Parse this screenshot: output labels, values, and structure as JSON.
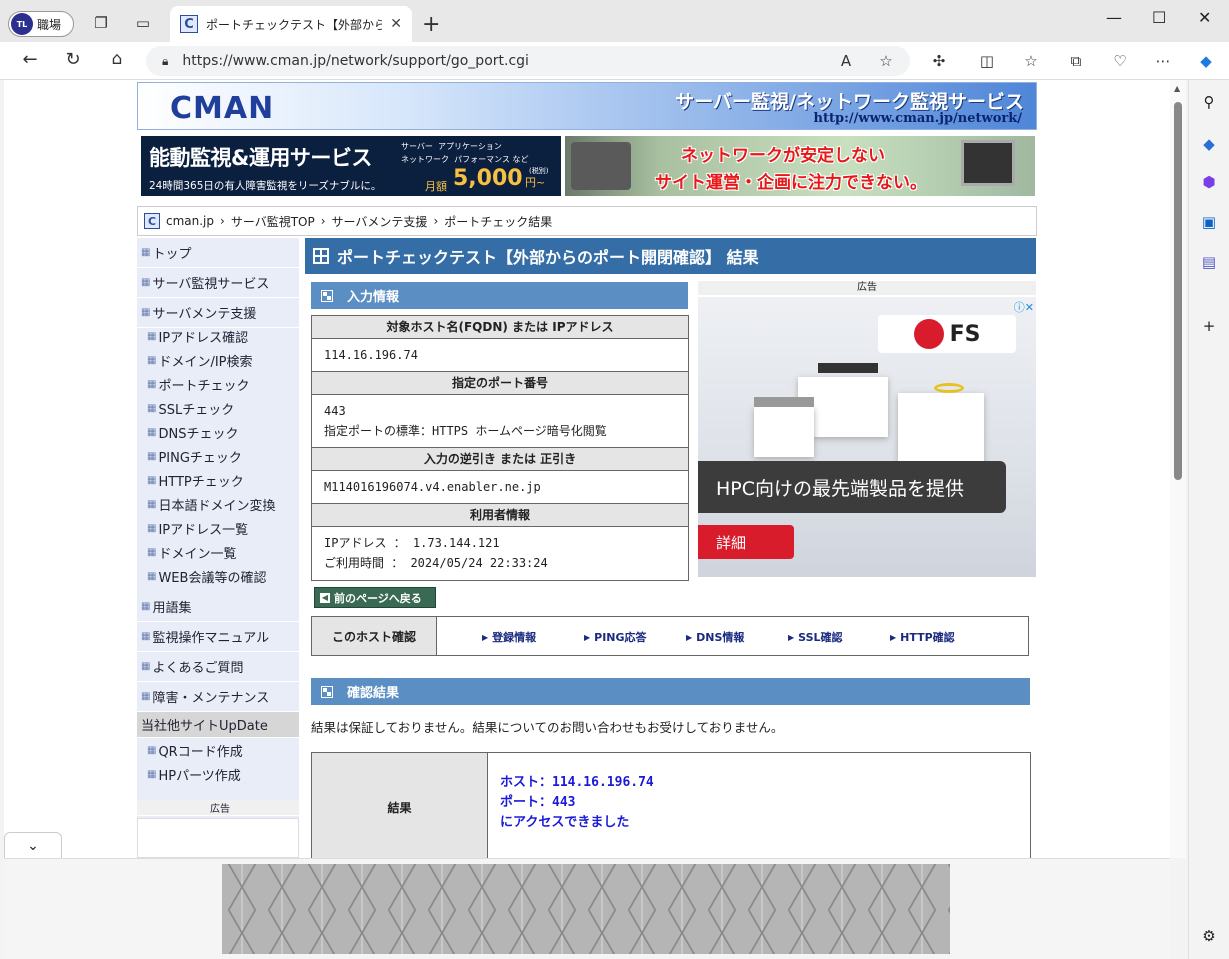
{
  "browser": {
    "profile_label": "職場",
    "profile_avatar": "TL",
    "tab_title": "ポートチェックテスト【外部からのポート開閉確認】",
    "url": "https://www.cman.jp/network/support/go_port.cgi",
    "icons": [
      "workspaces-icon",
      "tab-actions-icon",
      "close-icon",
      "new-tab-icon",
      "minimize-icon",
      "maximize-icon",
      "back-icon",
      "refresh-icon",
      "home-icon",
      "lock-icon",
      "read-aloud-icon",
      "favorite-star-icon",
      "extensions-icon",
      "split-screen-icon",
      "favorites-icon",
      "collections-icon",
      "health-icon",
      "more-icon",
      "copilot-icon"
    ]
  },
  "header": {
    "logo": "CMAN",
    "title": "サーバー監視/ネットワーク監視サービス",
    "url_text": "http://www.cman.jp/network/"
  },
  "banner1": {
    "main": "能動監視&運用サービス",
    "checks": [
      "サーバー",
      "アプリケーション",
      "ネットワーク",
      "パフォーマンス など"
    ],
    "sub": "24時間365日の有人障害監視をリーズナブルに。",
    "price_prefix": "月額",
    "price": "5,000",
    "price_suffix": "円~",
    "tax": "(税別)"
  },
  "banner2": {
    "line1": "ネットワークが安定しない",
    "line2": "サイト運営・企画に注力できない。"
  },
  "breadcrumb": [
    "cman.jp",
    "サーバ監視TOP",
    "サーバメンテ支援",
    "ポートチェック結果"
  ],
  "leftnav": {
    "items": [
      {
        "label": "トップ",
        "sub": false
      },
      {
        "label": "サーバ監視サービス",
        "sub": false
      },
      {
        "label": "サーバメンテ支援",
        "sub": false
      },
      {
        "label": "IPアドレス確認",
        "sub": true
      },
      {
        "label": "ドメイン/IP検索",
        "sub": true
      },
      {
        "label": "ポートチェック",
        "sub": true
      },
      {
        "label": "SSLチェック",
        "sub": true
      },
      {
        "label": "DNSチェック",
        "sub": true
      },
      {
        "label": "PINGチェック",
        "sub": true
      },
      {
        "label": "HTTPチェック",
        "sub": true
      },
      {
        "label": "日本語ドメイン変換",
        "sub": true
      },
      {
        "label": "IPアドレス一覧",
        "sub": true
      },
      {
        "label": "ドメイン一覧",
        "sub": true
      },
      {
        "label": "WEB会議等の確認",
        "sub": true
      },
      {
        "label": "用語集",
        "sub": false
      },
      {
        "label": "監視操作マニュアル",
        "sub": false
      },
      {
        "label": "よくあるご質問",
        "sub": false
      },
      {
        "label": "障害・メンテナンス",
        "sub": false
      }
    ],
    "update_label": "当社他サイトUpDate",
    "update_items": [
      "QRコード作成",
      "HPパーツ作成"
    ],
    "ad_label": "広告"
  },
  "main": {
    "title": "ポートチェックテスト【外部からのポート開閉確認】 結果",
    "input_section": "入力情報",
    "rows": [
      {
        "head": "対象ホスト名(FQDN) または IPアドレス",
        "values": [
          "114.16.196.74"
        ]
      },
      {
        "head": "指定のポート番号",
        "values": [
          "443",
          "指定ポートの標準：HTTPS ホームページ暗号化閲覧"
        ]
      },
      {
        "head": "入力の逆引き または 正引き",
        "values": [
          "M114016196074.v4.enabler.ne.jp"
        ]
      },
      {
        "head": "利用者情報",
        "values": [
          "IPアドレス ： 1.73.144.121",
          "ご利用時間 ： 2024/05/24 22:33:24"
        ]
      }
    ],
    "ad_label": "広告",
    "ad_brand": "FS",
    "ad_text": "HPC向けの最先端製品を提供",
    "ad_button": "詳細",
    "back_button": "前のページへ戻る",
    "host_check_label": "このホスト確認",
    "host_links": [
      "登録情報",
      "PING応答",
      "DNS情報",
      "SSL確認",
      "HTTP確認"
    ],
    "result_section": "確認結果",
    "disclaimer": "結果は保証しておりません。結果についてのお問い合わせもお受けしておりません。",
    "result_label": "結果",
    "result_lines": [
      "ホスト：114.16.196.74",
      "ポート：443",
      "にアクセスできました"
    ]
  }
}
